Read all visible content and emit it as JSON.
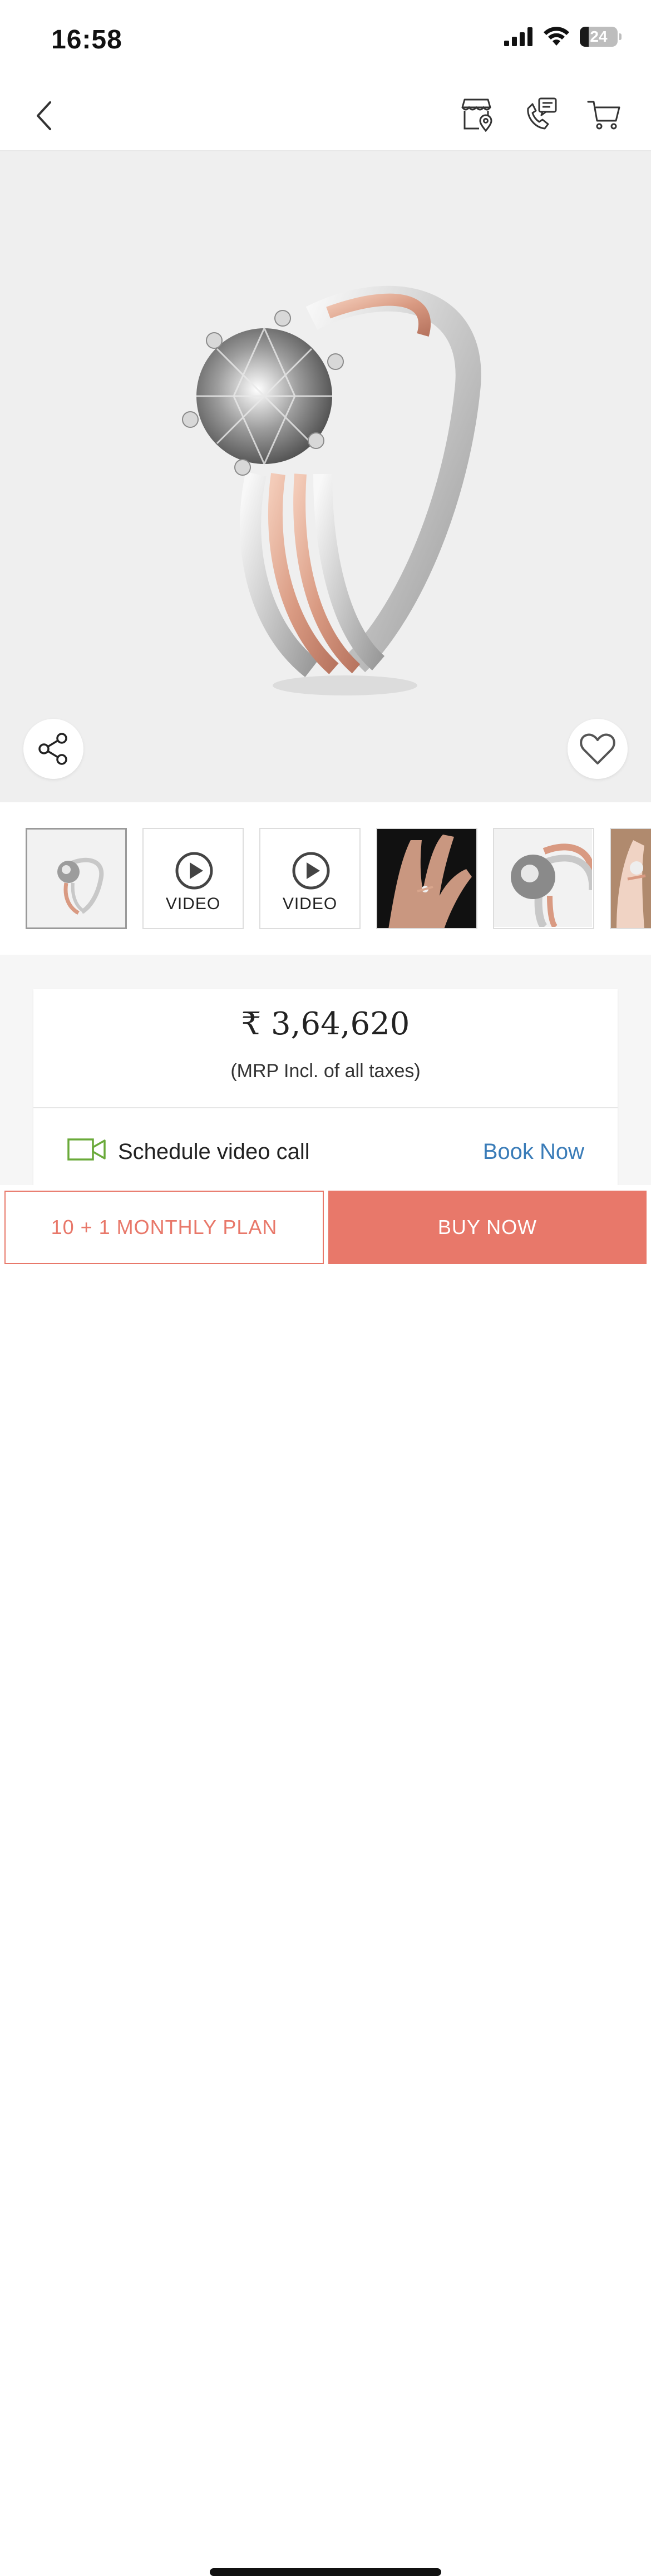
{
  "status_bar": {
    "time": "16:58",
    "battery_level": "24"
  },
  "nav": {
    "icons": [
      "back-chevron-icon",
      "store-locator-icon",
      "phone-chat-icon",
      "cart-icon"
    ]
  },
  "gallery": {
    "hero_alt": "Solitaire diamond ring with rose gold and white gold split band",
    "thumbnails": [
      {
        "kind": "image",
        "label": ""
      },
      {
        "kind": "video",
        "label": "VIDEO"
      },
      {
        "kind": "video",
        "label": "VIDEO"
      },
      {
        "kind": "image",
        "label": ""
      },
      {
        "kind": "image",
        "label": ""
      },
      {
        "kind": "image",
        "label": ""
      }
    ]
  },
  "product": {
    "price": "₹ 3,64,620",
    "mrp_note": "(MRP Incl. of all taxes)"
  },
  "video_call": {
    "label": "Schedule video call",
    "action": "Book Now"
  },
  "actions": {
    "plan_label": "10 + 1 MONTHLY PLAN",
    "buy_label": "BUY NOW"
  },
  "colors": {
    "accent": "#e8786a",
    "link": "#3a7cb8",
    "video_icon": "#6aaa3a"
  }
}
